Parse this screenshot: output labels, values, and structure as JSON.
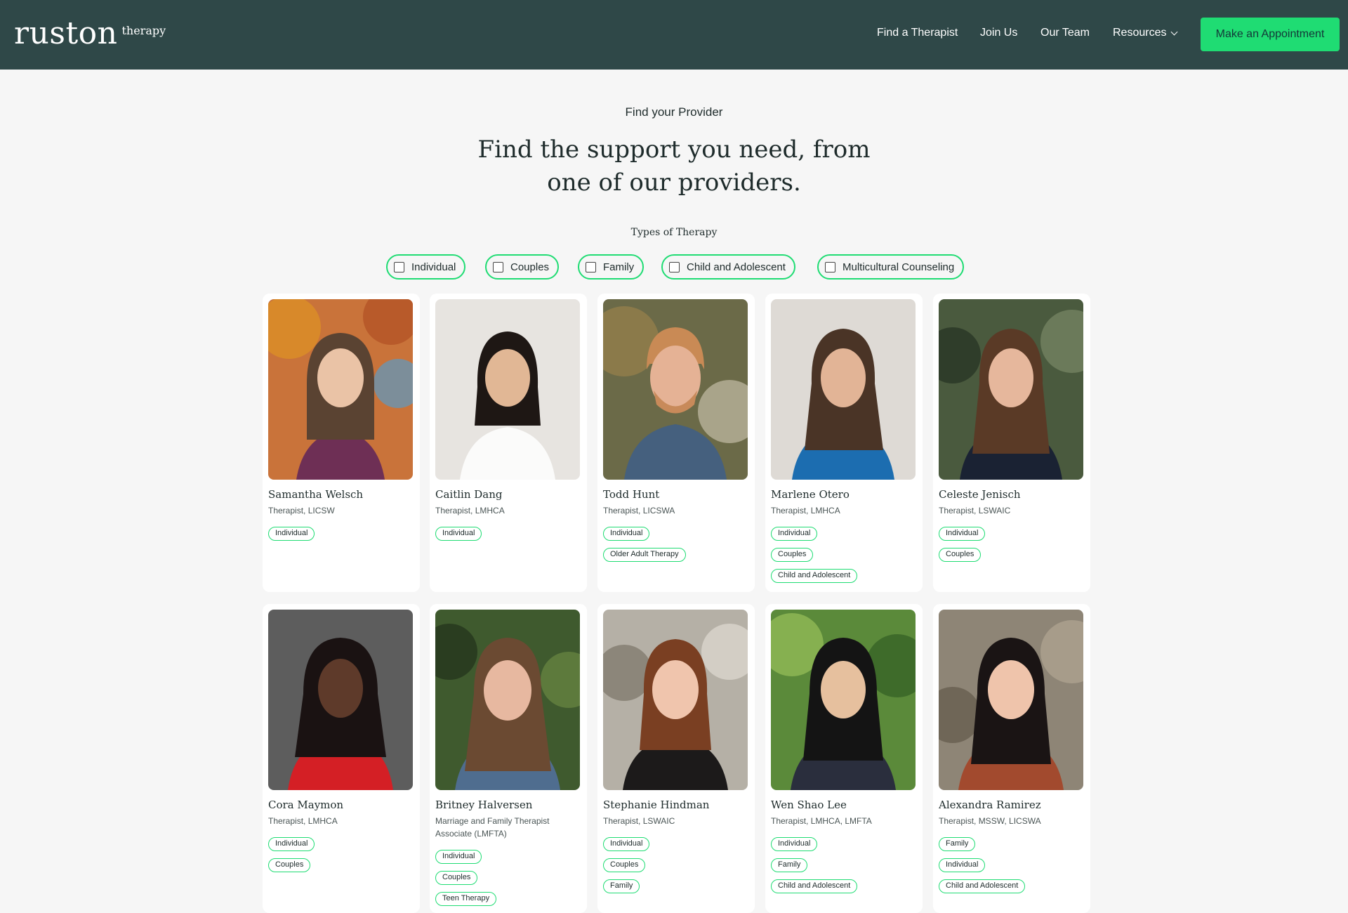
{
  "brand": {
    "name": "ruston",
    "sub": "therapy"
  },
  "nav": {
    "find": "Find a Therapist",
    "join": "Join Us",
    "team": "Our Team",
    "resources": "Resources",
    "cta": "Make an Appointment"
  },
  "hero": {
    "eyebrow": "Find your Provider",
    "line1": "Find the support you need, from",
    "line2": "one of our providers."
  },
  "filters": {
    "label": "Types of Therapy",
    "options": [
      "Individual",
      "Couples",
      "Family",
      "Child and Adolescent",
      "Multicultural Counseling"
    ]
  },
  "providers": [
    {
      "name": "Samantha Welsch",
      "cred": "Therapist, LICSW",
      "tags": [
        "Individual"
      ]
    },
    {
      "name": "Caitlin Dang",
      "cred": "Therapist, LMHCA",
      "tags": [
        "Individual"
      ]
    },
    {
      "name": "Todd Hunt",
      "cred": "Therapist, LICSWA",
      "tags": [
        "Individual",
        "Older Adult Therapy"
      ]
    },
    {
      "name": "Marlene Otero",
      "cred": "Therapist, LMHCA",
      "tags": [
        "Individual",
        "Couples",
        "Child and Adolescent"
      ]
    },
    {
      "name": "Celeste Jenisch",
      "cred": "Therapist, LSWAIC",
      "tags": [
        "Individual",
        "Couples"
      ]
    },
    {
      "name": "Cora Maymon",
      "cred": "Therapist, LMHCA",
      "tags": [
        "Individual",
        "Couples"
      ]
    },
    {
      "name": "Britney Halversen",
      "cred": "Marriage and Family Therapist Associate (LMFTA)",
      "tags": [
        "Individual",
        "Couples",
        "Teen Therapy"
      ]
    },
    {
      "name": "Stephanie Hindman",
      "cred": "Therapist, LSWAIC",
      "tags": [
        "Individual",
        "Couples",
        "Family"
      ]
    },
    {
      "name": "Wen Shao Lee",
      "cred": "Therapist, LMHCA, LMFTA",
      "tags": [
        "Individual",
        "Family",
        "Child and Adolescent"
      ]
    },
    {
      "name": "Alexandra Ramirez",
      "cred": "Therapist, MSSW, LICSWA",
      "tags": [
        "Family",
        "Individual",
        "Child and Adolescent"
      ]
    }
  ],
  "colors": {
    "nav_bg": "#2f4848",
    "accent": "#1fdc73",
    "page_bg": "#f6f6f6"
  }
}
